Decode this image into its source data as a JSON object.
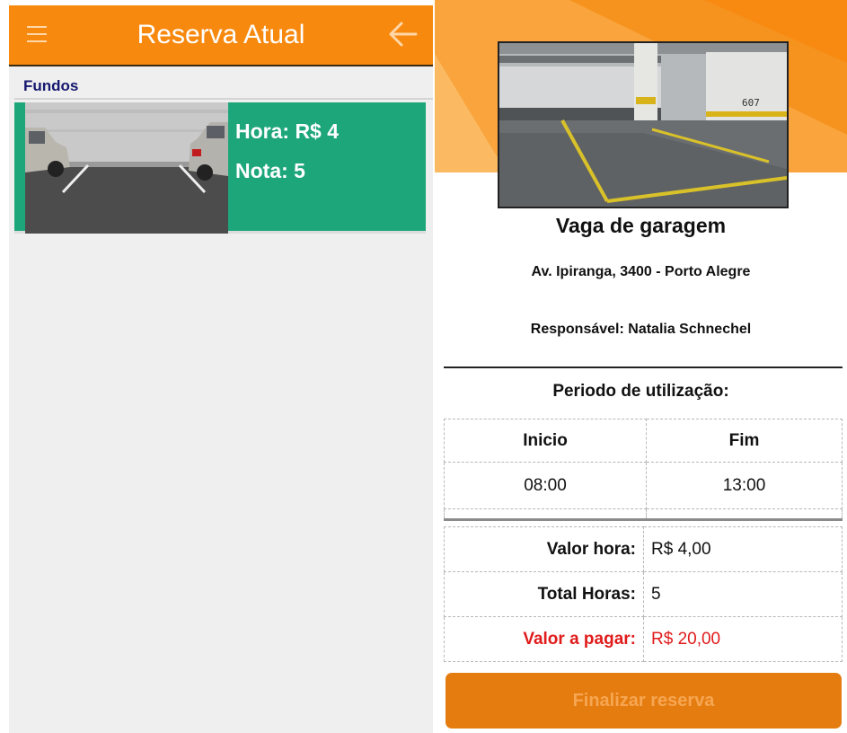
{
  "left_screen": {
    "title": "Reserva Atual",
    "section_label": "Fundos",
    "card": {
      "hour_text": "Hora: R$ 4",
      "rating_text": "Nota: 5"
    },
    "icons": [
      "menu-icon",
      "arrow-left-icon"
    ]
  },
  "right_screen": {
    "place_title": "Vaga de garagem",
    "address": "Av. Ipiranga, 3400 - Porto Alegre",
    "owner": "Responsável: Natalia Schnechel",
    "period_label": "Periodo de utilização:",
    "photo_number": "607",
    "times": {
      "start_header": "Inicio",
      "end_header": "Fim",
      "start_value": "08:00",
      "end_value": "13:00"
    },
    "summary": {
      "hour_rate_label": "Valor hora:",
      "hour_rate_value": "R$ 4,00",
      "total_hours_label": "Total Horas:",
      "total_hours_value": "5",
      "amount_label": "Valor a pagar:",
      "amount_value": "R$ 20,00"
    },
    "finish_button": "Finalizar reserva"
  },
  "colors": {
    "accent_orange": "#f7890f",
    "card_green": "#1ea67b",
    "section_blue": "#15186e",
    "alert_red": "#e01b1b"
  }
}
